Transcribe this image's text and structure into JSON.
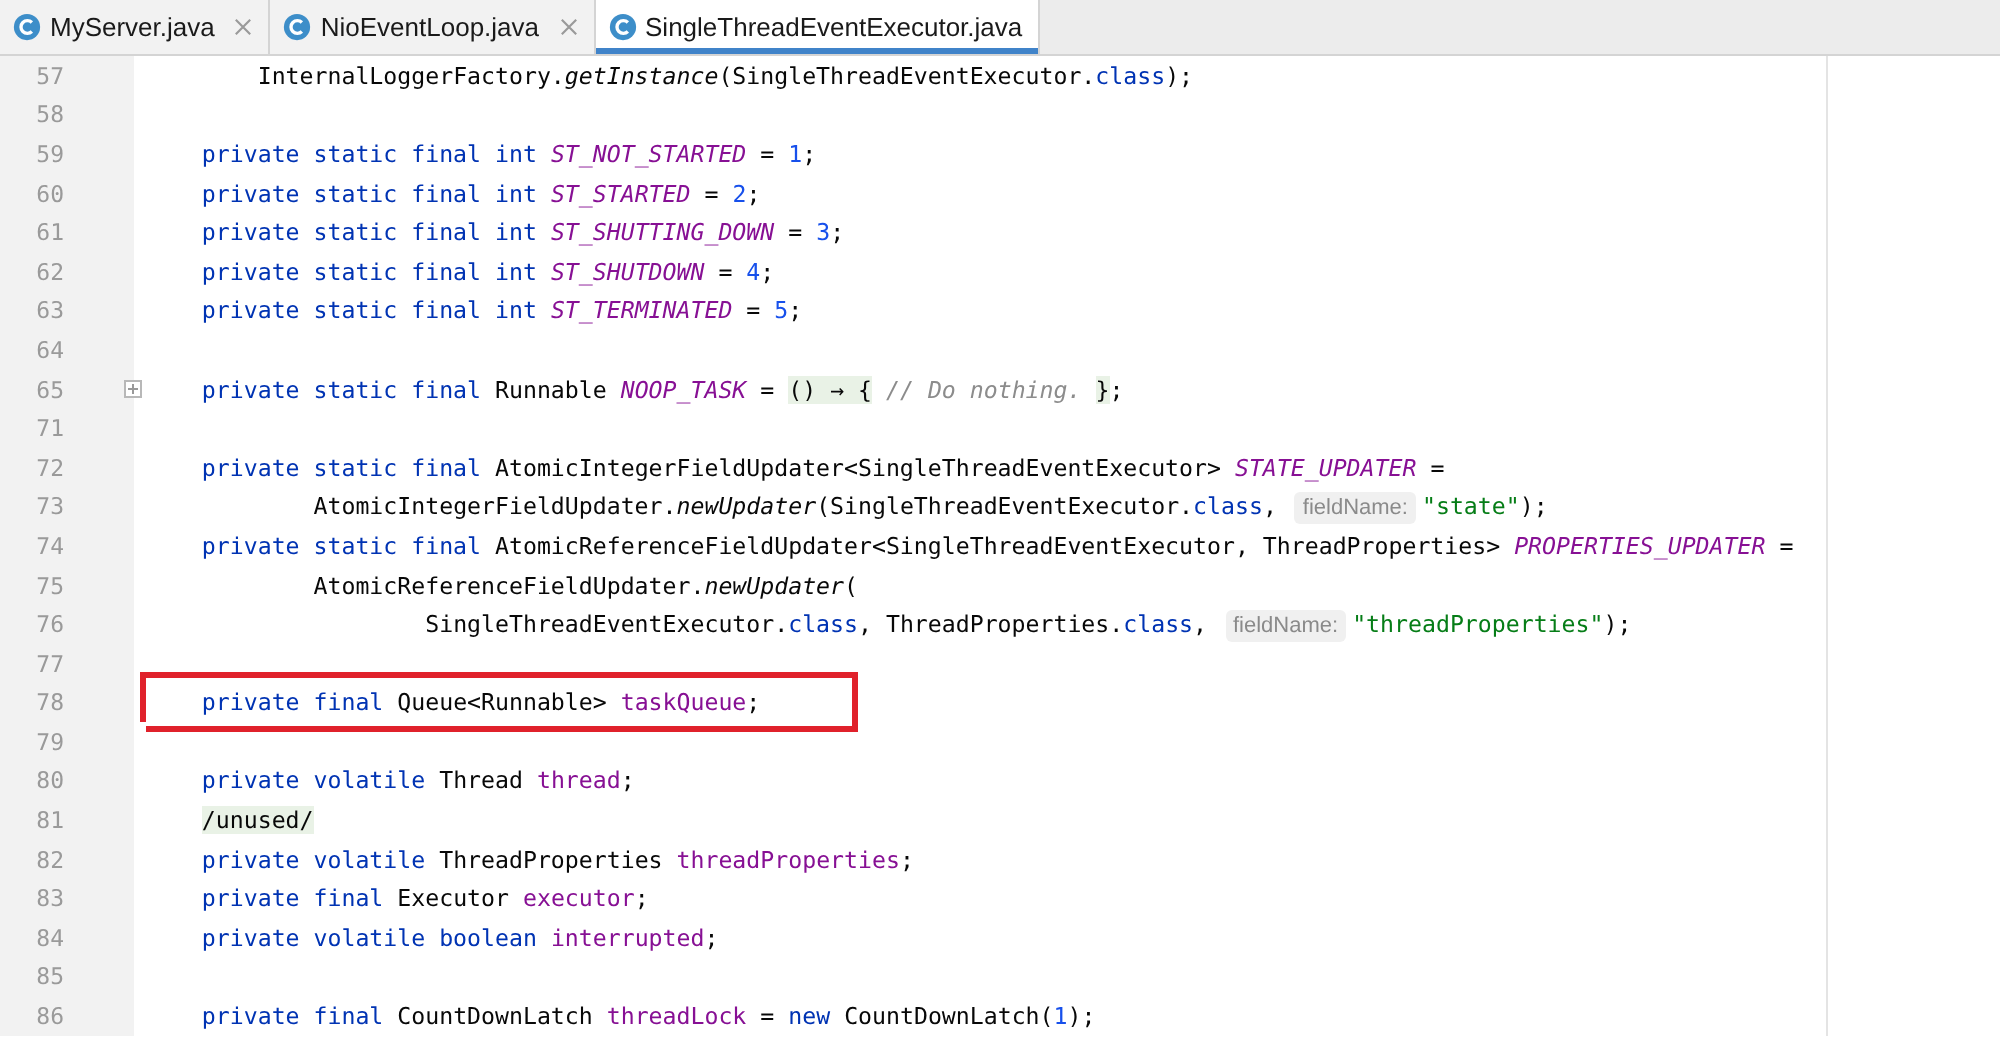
{
  "tabs": [
    {
      "label": "MyServer.java",
      "selected": false,
      "closable": true
    },
    {
      "label": "NioEventLoop.java",
      "selected": false,
      "closable": true
    },
    {
      "label": "SingleThreadEventExecutor.java",
      "selected": true,
      "closable": false
    }
  ],
  "lines": [
    {
      "number": "57",
      "folded": false,
      "highlighted": false,
      "tokens": [
        {
          "kind": "plain",
          "t": "        InternalLoggerFactory."
        },
        {
          "kind": "method",
          "t": "getInstance"
        },
        {
          "kind": "plain",
          "t": "(SingleThreadEventExecutor."
        },
        {
          "kind": "kw",
          "t": "class"
        },
        {
          "kind": "plain",
          "t": ");"
        }
      ]
    },
    {
      "number": "58",
      "folded": false
    },
    {
      "number": "59",
      "folded": false,
      "highlighted": false,
      "tokens": [
        {
          "kind": "kw",
          "t": "    private static final int "
        },
        {
          "kind": "static",
          "t": "ST_NOT_STARTED"
        },
        {
          "kind": "plain",
          "t": " = "
        },
        {
          "kind": "num",
          "t": "1"
        },
        {
          "kind": "plain",
          "t": ";"
        }
      ]
    },
    {
      "number": "60",
      "folded": false,
      "highlighted": false,
      "tokens": [
        {
          "kind": "kw",
          "t": "    private static final int "
        },
        {
          "kind": "static",
          "t": "ST_STARTED"
        },
        {
          "kind": "plain",
          "t": " = "
        },
        {
          "kind": "num",
          "t": "2"
        },
        {
          "kind": "plain",
          "t": ";"
        }
      ]
    },
    {
      "number": "61",
      "folded": false,
      "highlighted": false,
      "tokens": [
        {
          "kind": "kw",
          "t": "    private static final int "
        },
        {
          "kind": "static",
          "t": "ST_SHUTTING_DOWN"
        },
        {
          "kind": "plain",
          "t": " = "
        },
        {
          "kind": "num",
          "t": "3"
        },
        {
          "kind": "plain",
          "t": ";"
        }
      ]
    },
    {
      "number": "62",
      "folded": false,
      "highlighted": false,
      "tokens": [
        {
          "kind": "kw",
          "t": "    private static final int "
        },
        {
          "kind": "static",
          "t": "ST_SHUTDOWN"
        },
        {
          "kind": "plain",
          "t": " = "
        },
        {
          "kind": "num",
          "t": "4"
        },
        {
          "kind": "plain",
          "t": ";"
        }
      ]
    },
    {
      "number": "63",
      "folded": false,
      "highlighted": false,
      "tokens": [
        {
          "kind": "kw",
          "t": "    private static final int "
        },
        {
          "kind": "static",
          "t": "ST_TERMINATED"
        },
        {
          "kind": "plain",
          "t": " = "
        },
        {
          "kind": "num",
          "t": "5"
        },
        {
          "kind": "plain",
          "t": ";"
        }
      ]
    },
    {
      "number": "64",
      "folded": false
    },
    {
      "number": "65",
      "folded": true,
      "highlighted": false,
      "tokens": [
        {
          "kind": "kw",
          "t": "    private static final "
        },
        {
          "kind": "plain",
          "t": "Runnable "
        },
        {
          "kind": "static",
          "t": "NOOP_TASK"
        },
        {
          "kind": "plain",
          "t": " = "
        },
        {
          "kind": "fold",
          "t": "() → {"
        },
        {
          "kind": "comment",
          "t": " // Do nothing. "
        },
        {
          "kind": "fold",
          "t": "}"
        },
        {
          "kind": "plain",
          "t": ";"
        }
      ]
    },
    {
      "number": "71",
      "folded": false
    },
    {
      "number": "72",
      "folded": false,
      "highlighted": false,
      "tokens": [
        {
          "kind": "kw",
          "t": "    private static final "
        },
        {
          "kind": "plain",
          "t": "AtomicIntegerFieldUpdater<SingleThreadEventExecutor> "
        },
        {
          "kind": "static",
          "t": "STATE_UPDATER"
        },
        {
          "kind": "plain",
          "t": " ="
        }
      ]
    },
    {
      "number": "73",
      "folded": false,
      "highlighted": false,
      "tokens": [
        {
          "kind": "plain",
          "t": "            AtomicIntegerFieldUpdater."
        },
        {
          "kind": "method",
          "t": "newUpdater"
        },
        {
          "kind": "plain",
          "t": "(SingleThreadEventExecutor."
        },
        {
          "kind": "kw",
          "t": "class"
        },
        {
          "kind": "plain",
          "t": ", "
        },
        {
          "kind": "hint",
          "t": "fieldName:"
        },
        {
          "kind": "str",
          "t": "\"state\""
        },
        {
          "kind": "plain",
          "t": ");"
        }
      ]
    },
    {
      "number": "74",
      "folded": false,
      "highlighted": false,
      "tokens": [
        {
          "kind": "kw",
          "t": "    private static final "
        },
        {
          "kind": "plain",
          "t": "AtomicReferenceFieldUpdater<SingleThreadEventExecutor, ThreadProperties> "
        },
        {
          "kind": "static",
          "t": "PROPERTIES_UPDATER"
        },
        {
          "kind": "plain",
          "t": " ="
        }
      ]
    },
    {
      "number": "75",
      "folded": false,
      "highlighted": false,
      "tokens": [
        {
          "kind": "plain",
          "t": "            AtomicReferenceFieldUpdater."
        },
        {
          "kind": "method",
          "t": "newUpdater"
        },
        {
          "kind": "plain",
          "t": "("
        }
      ]
    },
    {
      "number": "76",
      "folded": false,
      "highlighted": false,
      "tokens": [
        {
          "kind": "plain",
          "t": "                    SingleThreadEventExecutor."
        },
        {
          "kind": "kw",
          "t": "class"
        },
        {
          "kind": "plain",
          "t": ", ThreadProperties."
        },
        {
          "kind": "kw",
          "t": "class"
        },
        {
          "kind": "plain",
          "t": ", "
        },
        {
          "kind": "hint",
          "t": "fieldName:"
        },
        {
          "kind": "str",
          "t": "\"threadProperties\""
        },
        {
          "kind": "plain",
          "t": ");"
        }
      ]
    },
    {
      "number": "77",
      "folded": false
    },
    {
      "number": "78",
      "folded": false,
      "highlighted": true,
      "tokens": [
        {
          "kind": "kw",
          "t": "    private final "
        },
        {
          "kind": "plain",
          "t": "Queue<Runnable> "
        },
        {
          "kind": "field",
          "t": "taskQueue"
        },
        {
          "kind": "plain",
          "t": ";"
        }
      ]
    },
    {
      "number": "79",
      "folded": false
    },
    {
      "number": "80",
      "folded": false,
      "highlighted": false,
      "tokens": [
        {
          "kind": "kw",
          "t": "    private volatile "
        },
        {
          "kind": "plain",
          "t": "Thread "
        },
        {
          "kind": "field",
          "t": "thread"
        },
        {
          "kind": "plain",
          "t": ";"
        }
      ]
    },
    {
      "number": "81",
      "folded": false,
      "highlighted": false,
      "tokens": [
        {
          "kind": "fold",
          "t": "    /unused/"
        }
      ]
    },
    {
      "number": "82",
      "folded": false,
      "highlighted": false,
      "tokens": [
        {
          "kind": "kw",
          "t": "    private volatile "
        },
        {
          "kind": "plain",
          "t": "ThreadProperties "
        },
        {
          "kind": "field",
          "t": "threadProperties"
        },
        {
          "kind": "plain",
          "t": ";"
        }
      ]
    },
    {
      "number": "83",
      "folded": false,
      "highlighted": false,
      "tokens": [
        {
          "kind": "kw",
          "t": "    private final "
        },
        {
          "kind": "plain",
          "t": "Executor "
        },
        {
          "kind": "field",
          "t": "executor"
        },
        {
          "kind": "plain",
          "t": ";"
        }
      ]
    },
    {
      "number": "84",
      "folded": false,
      "highlighted": false,
      "tokens": [
        {
          "kind": "kw",
          "t": "    private volatile boolean "
        },
        {
          "kind": "field",
          "t": "interrupted"
        },
        {
          "kind": "plain",
          "t": ";"
        }
      ]
    },
    {
      "number": "85",
      "folded": false
    },
    {
      "number": "86",
      "folded": false,
      "highlighted": false,
      "tokens": [
        {
          "kind": "kw",
          "t": "    private final "
        },
        {
          "kind": "plain",
          "t": "CountDownLatch "
        },
        {
          "kind": "field",
          "t": "threadLock"
        },
        {
          "kind": "plain",
          "t": " = "
        },
        {
          "kind": "kw",
          "t": "new"
        },
        {
          "kind": "plain",
          "t": " CountDownLatch("
        },
        {
          "kind": "num",
          "t": "1"
        },
        {
          "kind": "plain",
          "t": ");"
        }
      ]
    }
  ]
}
